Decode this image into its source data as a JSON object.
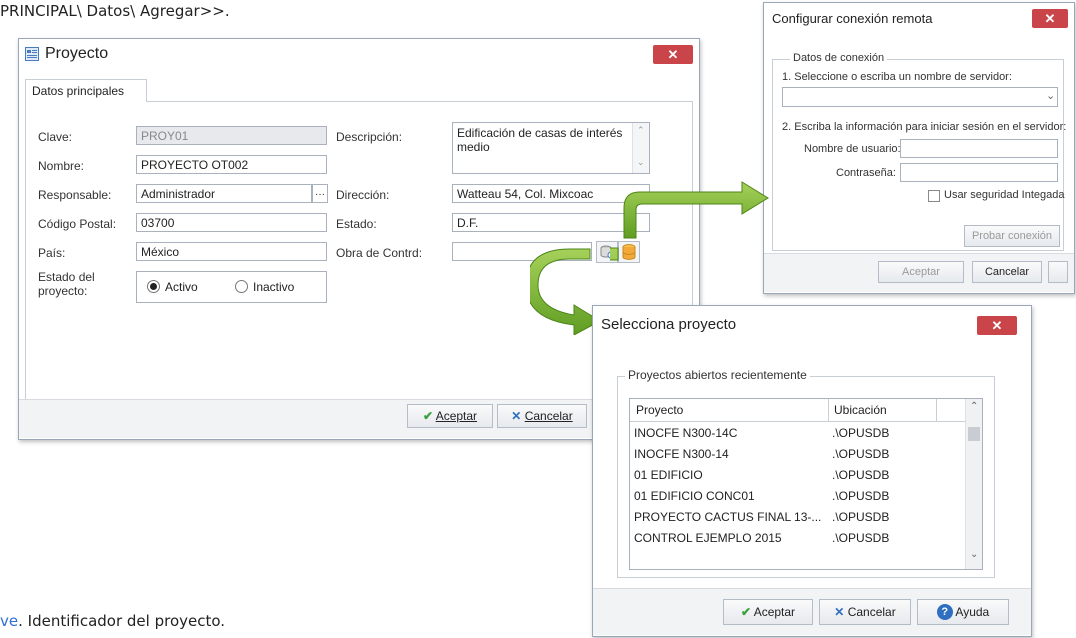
{
  "document": {
    "top_text_prefix": "PRINCIPAL\\ Datos\\ Agregar",
    "top_text_suffix": ">>.",
    "bottom_keyword": "ve",
    "bottom_text": ". Identificador del proyecto."
  },
  "proyecto": {
    "title": "Proyecto",
    "close": "✕",
    "tab": "Datos principales",
    "labels": {
      "clave": "Clave:",
      "nombre": "Nombre:",
      "responsable": "Responsable:",
      "codigo_postal": "Código Postal:",
      "pais": "País:",
      "estado_proyecto": "Estado del proyecto:",
      "descripcion": "Descripción:",
      "direccion": "Dirección:",
      "estado": "Estado:",
      "obra_contrd": "Obra de Contrd:"
    },
    "values": {
      "clave": "PROY01",
      "nombre": "PROYECTO OT002",
      "responsable": "Administrador",
      "codigo_postal": "03700",
      "pais": "México",
      "descripcion": "Edificación de casas de interés medio",
      "direccion": "Watteau 54, Col. Mixcoac",
      "estado": "D.F.",
      "obra_contrd": ""
    },
    "ellipsis": "···",
    "radio_activo": "Activo",
    "radio_inactivo": "Inactivo",
    "accept": "Aceptar",
    "cancel": "Cancelar"
  },
  "conexion": {
    "title": "Configurar conexión remota",
    "close": "✕",
    "group": "Datos de conexión",
    "step1": "1. Seleccione o escriba un nombre de servidor:",
    "server_value": "",
    "step2": "2. Escriba la información para iniciar sesión en el servidor:",
    "user_label": "Nombre de usuario:",
    "pass_label": "Contraseña:",
    "integrated": "Usar seguridad Integada",
    "test": "Probar conexión",
    "accept": "Aceptar",
    "cancel": "Cancelar"
  },
  "selecciona": {
    "title": "Selecciona proyecto",
    "close": "✕",
    "group": "Proyectos abiertos recientemente",
    "col_proyecto": "Proyecto",
    "col_ubicacion": "Ubicación",
    "rows": [
      {
        "proyecto": "INOCFE N300-14C",
        "ubicacion": ".\\OPUSDB"
      },
      {
        "proyecto": "INOCFE N300-14",
        "ubicacion": ".\\OPUSDB"
      },
      {
        "proyecto": "01 EDIFICIO",
        "ubicacion": ".\\OPUSDB"
      },
      {
        "proyecto": "01 EDIFICIO CONC01",
        "ubicacion": ".\\OPUSDB"
      },
      {
        "proyecto": "PROYECTO CACTUS FINAL 13-...",
        "ubicacion": ".\\OPUSDB"
      },
      {
        "proyecto": "CONTROL EJEMPLO 2015",
        "ubicacion": ".\\OPUSDB"
      }
    ],
    "accept": "Aceptar",
    "cancel": "Cancelar",
    "help": "Ayuda"
  }
}
